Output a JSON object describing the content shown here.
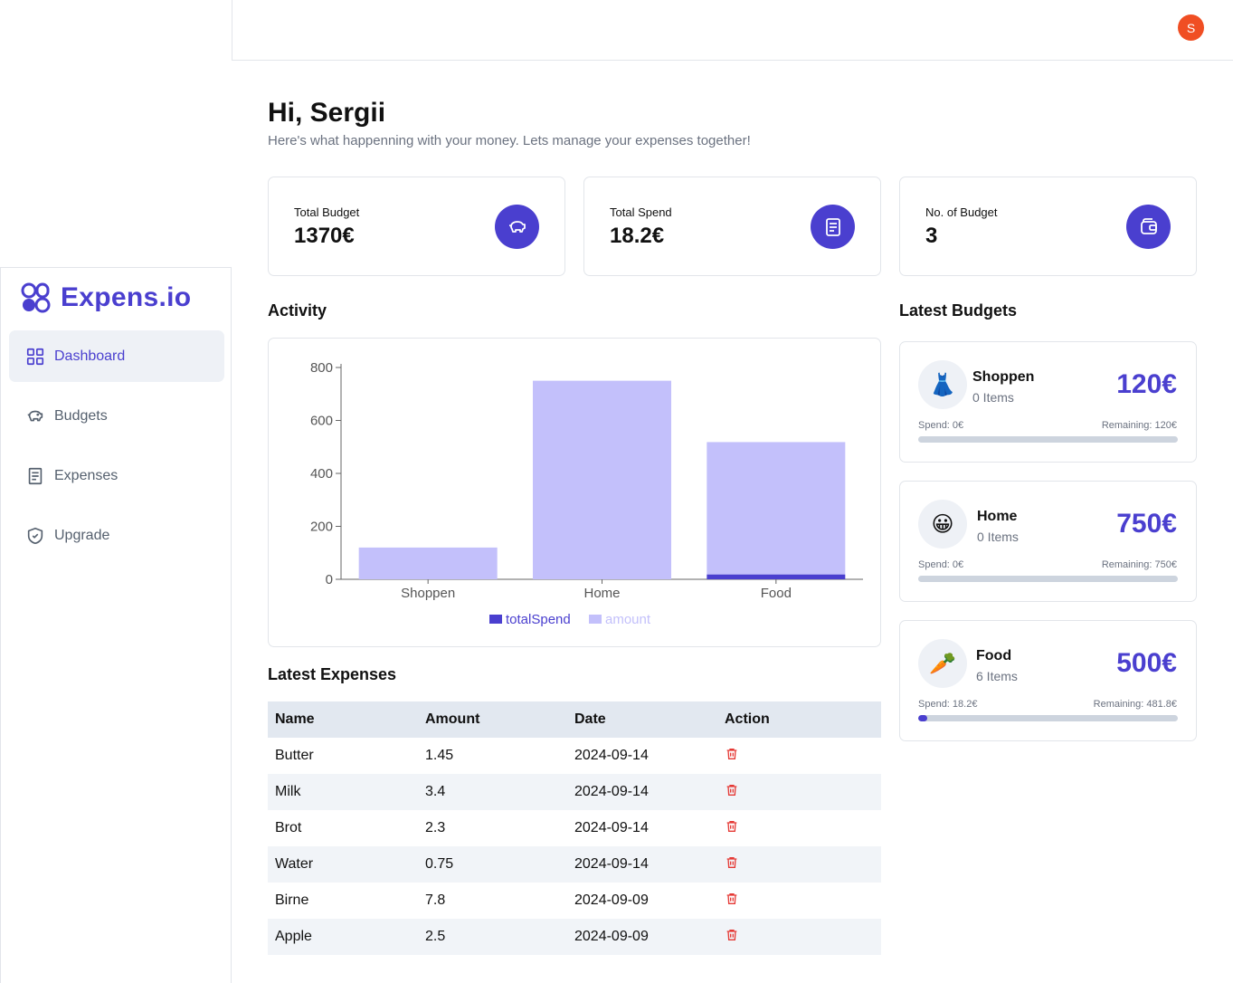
{
  "header": {
    "avatar_initial": "S"
  },
  "sidebar": {
    "logo_text": "Expens.io",
    "items": [
      {
        "label": "Dashboard",
        "icon": "grid-icon",
        "active": true
      },
      {
        "label": "Budgets",
        "icon": "piggy-bank-icon"
      },
      {
        "label": "Expenses",
        "icon": "receipt-icon"
      },
      {
        "label": "Upgrade",
        "icon": "shield-icon"
      }
    ]
  },
  "main": {
    "greeting": "Hi, Sergii",
    "subtitle": "Here's what happenning with your money. Lets manage your expenses together!",
    "stats": [
      {
        "label": "Total Budget",
        "value": "1370€",
        "icon": "piggy-bank-icon"
      },
      {
        "label": "Total Spend",
        "value": "18.2€",
        "icon": "receipt-icon"
      },
      {
        "label": "No. of Budget",
        "value": "3",
        "icon": "wallet-icon"
      }
    ],
    "activity_title": "Activity",
    "latest_expenses_title": "Latest Expenses",
    "latest_budgets_title": "Latest Budgets"
  },
  "chart_data": {
    "type": "bar",
    "categories": [
      "Shoppen",
      "Home",
      "Food"
    ],
    "series": [
      {
        "name": "totalSpend",
        "values": [
          0,
          0,
          18.2
        ],
        "color": "#4a3fcf"
      },
      {
        "name": "amount",
        "values": [
          120,
          750,
          500
        ],
        "color": "#c3c0fb"
      }
    ],
    "stacked": true,
    "yticks": [
      0,
      200,
      400,
      600,
      800
    ],
    "ylim": [
      0,
      800
    ],
    "legend": "bottom"
  },
  "expenses": {
    "columns": [
      "Name",
      "Amount",
      "Date",
      "Action"
    ],
    "rows": [
      {
        "name": "Butter",
        "amount": "1.45",
        "date": "2024-09-14"
      },
      {
        "name": "Milk",
        "amount": "3.4",
        "date": "2024-09-14"
      },
      {
        "name": "Brot",
        "amount": "2.3",
        "date": "2024-09-14"
      },
      {
        "name": "Water",
        "amount": "0.75",
        "date": "2024-09-14"
      },
      {
        "name": "Birne",
        "amount": "7.8",
        "date": "2024-09-09"
      },
      {
        "name": "Apple",
        "amount": "2.5",
        "date": "2024-09-09"
      }
    ],
    "action_icon": "trash-icon"
  },
  "budgets": [
    {
      "emoji": "👗",
      "name": "Shoppen",
      "items": "0 Items",
      "amount": "120€",
      "spend": "Spend: 0€",
      "remaining": "Remaining: 120€",
      "progress": 0
    },
    {
      "emoji": "😀",
      "name": "Home",
      "items": "0 Items",
      "amount": "750€",
      "spend": "Spend: 0€",
      "remaining": "Remaining: 750€",
      "progress": 0
    },
    {
      "emoji": "🥕",
      "name": "Food",
      "items": "6 Items",
      "amount": "500€",
      "spend": "Spend: 18.2€",
      "remaining": "Remaining: 481.8€",
      "progress": 0.0364
    }
  ]
}
